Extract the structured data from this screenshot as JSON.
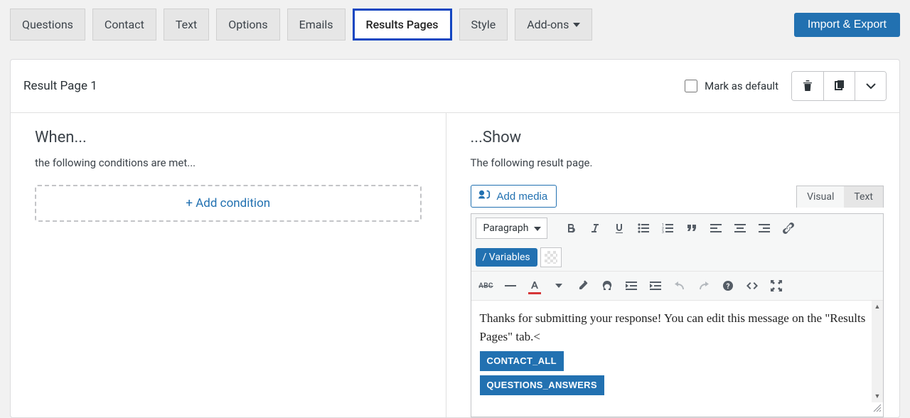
{
  "tabs": [
    {
      "label": "Questions",
      "active": false
    },
    {
      "label": "Contact",
      "active": false
    },
    {
      "label": "Text",
      "active": false
    },
    {
      "label": "Options",
      "active": false
    },
    {
      "label": "Emails",
      "active": false
    },
    {
      "label": "Results Pages",
      "active": true
    },
    {
      "label": "Style",
      "active": false
    },
    {
      "label": "Add-ons",
      "active": false,
      "dropdown": true
    }
  ],
  "header": {
    "import_export": "Import & Export"
  },
  "panel": {
    "title": "Result Page 1",
    "mark_as_default": "Mark as default"
  },
  "left": {
    "title": "When...",
    "subtitle": "the following conditions are met...",
    "add_condition": "+ Add condition"
  },
  "right": {
    "title": "...Show",
    "subtitle": "The following result page.",
    "add_media": "Add media",
    "view_visual": "Visual",
    "view_text": "Text",
    "format_selected": "Paragraph",
    "variables_label": "/ Variables",
    "editor_content": "Thanks for submitting your response! You can edit this message on the \"Results Pages\" tab.",
    "tags": [
      "CONTACT_ALL",
      "QUESTIONS_ANSWERS"
    ]
  },
  "colors": {
    "accent": "#2271b1",
    "active_border": "#1346c1"
  }
}
